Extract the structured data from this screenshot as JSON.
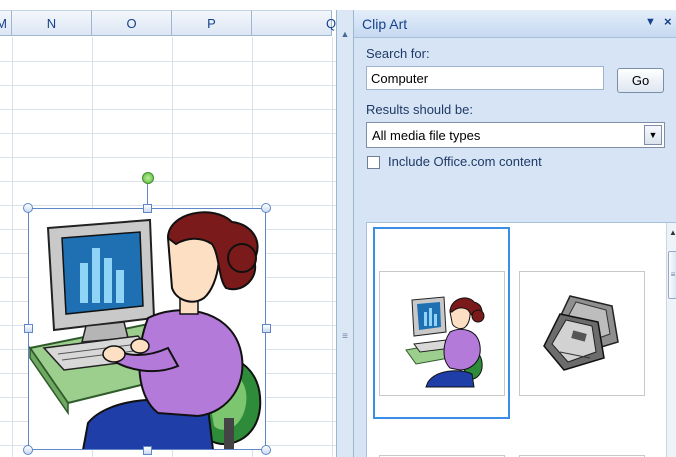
{
  "spreadsheet": {
    "columns": [
      "M",
      "N",
      "O",
      "P",
      "Q"
    ]
  },
  "clip_art_pane": {
    "title": "Clip Art",
    "search_label": "Search for:",
    "search_value": "Computer",
    "go_label": "Go",
    "results_label": "Results should be:",
    "media_type_value": "All media file types",
    "include_office_label": "Include Office.com content",
    "include_office_checked": false,
    "results": [
      {
        "icon": "woman-at-computer-icon",
        "selected": true
      },
      {
        "icon": "floppy-disks-icon",
        "selected": false
      }
    ]
  },
  "icons": {
    "pane_dropdown": "triangle-down-icon",
    "pane_close": "close-icon",
    "select_arrow": "chevron-down-icon",
    "scroll_up": "triangle-up-icon"
  },
  "colors": {
    "pane_background": "#d6e4f5",
    "header_text": "#15428b",
    "selection_border": "#3a8ee6"
  }
}
